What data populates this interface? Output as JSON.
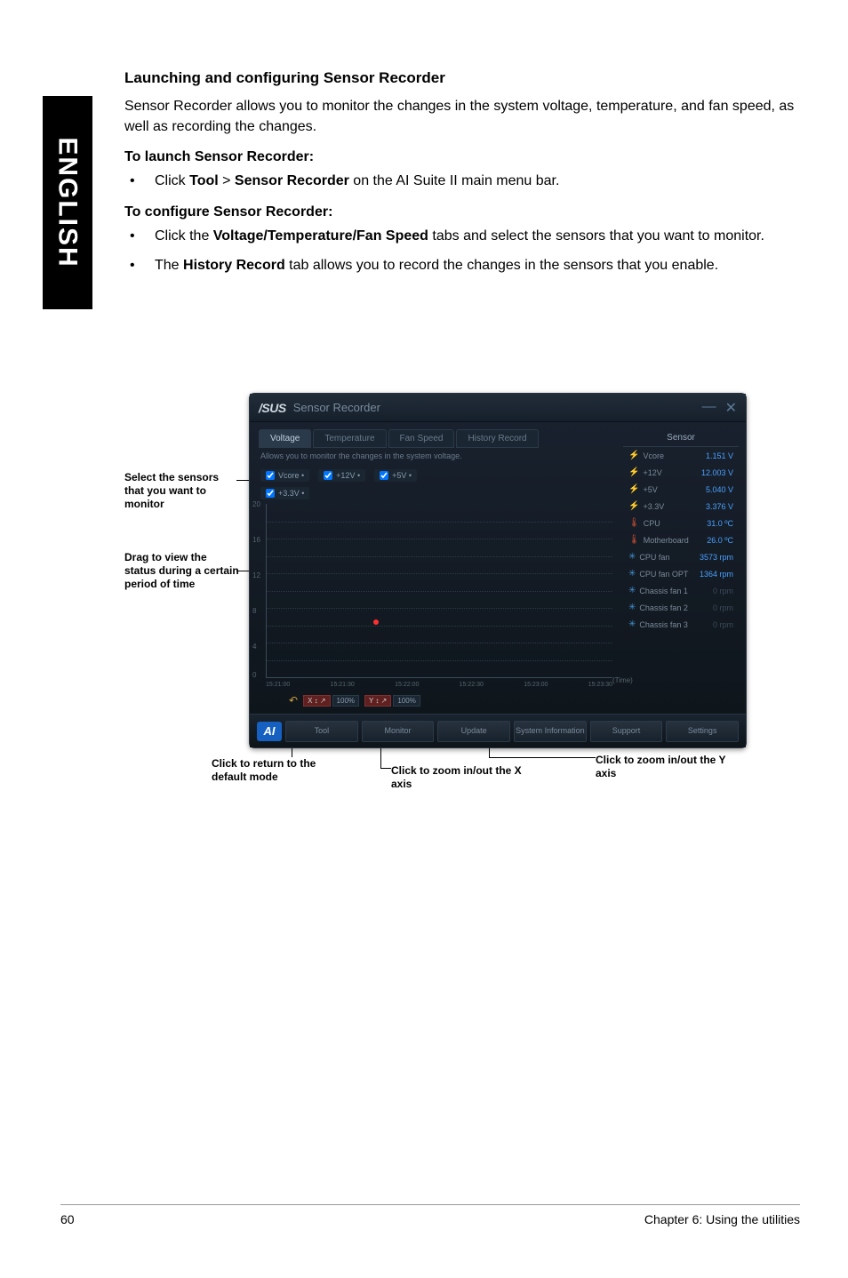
{
  "sidebar": {
    "lang": "ENGLISH"
  },
  "page": {
    "title": "Launching and configuring Sensor Recorder",
    "intro": "Sensor Recorder allows you to monitor the changes in the system voltage, temperature, and fan speed, as well as recording the changes.",
    "launch_head": "To launch Sensor Recorder:",
    "launch_bullet_pre": "Click ",
    "launch_bullet_b1": "Tool",
    "launch_bullet_mid": " > ",
    "launch_bullet_b2": "Sensor Recorder",
    "launch_bullet_post": " on the AI Suite II main menu bar.",
    "config_head": "To configure Sensor Recorder:",
    "config_b1_pre": "Click the ",
    "config_b1_bold": "Voltage/Temperature/Fan Speed",
    "config_b1_post": " tabs and select the sensors that you want to monitor.",
    "config_b2_pre": "The ",
    "config_b2_bold": "History Record",
    "config_b2_post": " tab allows you to record the changes in the sensors that you enable."
  },
  "annot": {
    "select": "Select the sensors that you want to monitor",
    "drag": "Drag to view the status during a certain period of time",
    "return": "Click to return to the default mode",
    "zoomx": "Click to zoom in/out the X axis",
    "zoomy": "Click to zoom in/out the Y axis"
  },
  "window": {
    "brand": "/SUS",
    "title": "Sensor Recorder",
    "tabs": {
      "voltage": "Voltage",
      "temperature": "Temperature",
      "fanspeed": "Fan Speed",
      "history": "History Record"
    },
    "hint": "Allows you to monitor the changes in the system voltage.",
    "checks": {
      "vcore": "Vcore •",
      "p12v": "+12V •",
      "p5v": "+5V •",
      "p33v": "+3.3V •"
    },
    "sensors_head": "Sensor",
    "sensors": [
      {
        "icon": "bolt",
        "label": "Vcore",
        "value": "1.151 V"
      },
      {
        "icon": "bolt",
        "label": "+12V",
        "value": "12.003 V"
      },
      {
        "icon": "bolt",
        "label": "+5V",
        "value": "5.040 V"
      },
      {
        "icon": "bolt",
        "label": "+3.3V",
        "value": "3.376 V"
      },
      {
        "icon": "therm",
        "label": "CPU",
        "value": "31.0 ºC"
      },
      {
        "icon": "therm",
        "label": "Motherboard",
        "value": "26.0 ºC"
      },
      {
        "icon": "fan",
        "label": "CPU fan",
        "value": "3573 rpm"
      },
      {
        "icon": "fan",
        "label": "CPU fan OPT",
        "value": "1364 rpm"
      },
      {
        "icon": "fan",
        "label": "Chassis fan 1",
        "value": "0 rpm",
        "dim": true
      },
      {
        "icon": "fan",
        "label": "Chassis fan 2",
        "value": "0 rpm",
        "dim": true
      },
      {
        "icon": "fan",
        "label": "Chassis fan 3",
        "value": "0 rpm",
        "dim": true
      }
    ],
    "time_label": "(Time)",
    "zoom": {
      "x_pct": "100%",
      "y_pct": "100%"
    },
    "bottom": {
      "tool": "Tool",
      "monitor": "Monitor",
      "update": "Update",
      "sysinfo": "System Information",
      "support": "Support",
      "settings": "Settings"
    }
  },
  "chart_data": {
    "type": "line",
    "title": "",
    "xlabel": "(Time)",
    "ylabel": "",
    "ylim": [
      0,
      20
    ],
    "y_ticks": [
      0,
      2,
      4,
      6,
      8,
      10,
      12,
      14,
      16,
      18,
      20
    ],
    "x_ticks": [
      "15:21:00",
      "15:21:30",
      "15:22:00",
      "15:22:30",
      "15:23:00",
      "15:23:30"
    ],
    "series": [
      {
        "name": "Vcore",
        "values": []
      },
      {
        "name": "+12V",
        "values": []
      },
      {
        "name": "+5V",
        "values": []
      },
      {
        "name": "+3.3V",
        "values": []
      }
    ]
  },
  "footer": {
    "page": "60",
    "chapter": "Chapter 6: Using the utilities"
  }
}
